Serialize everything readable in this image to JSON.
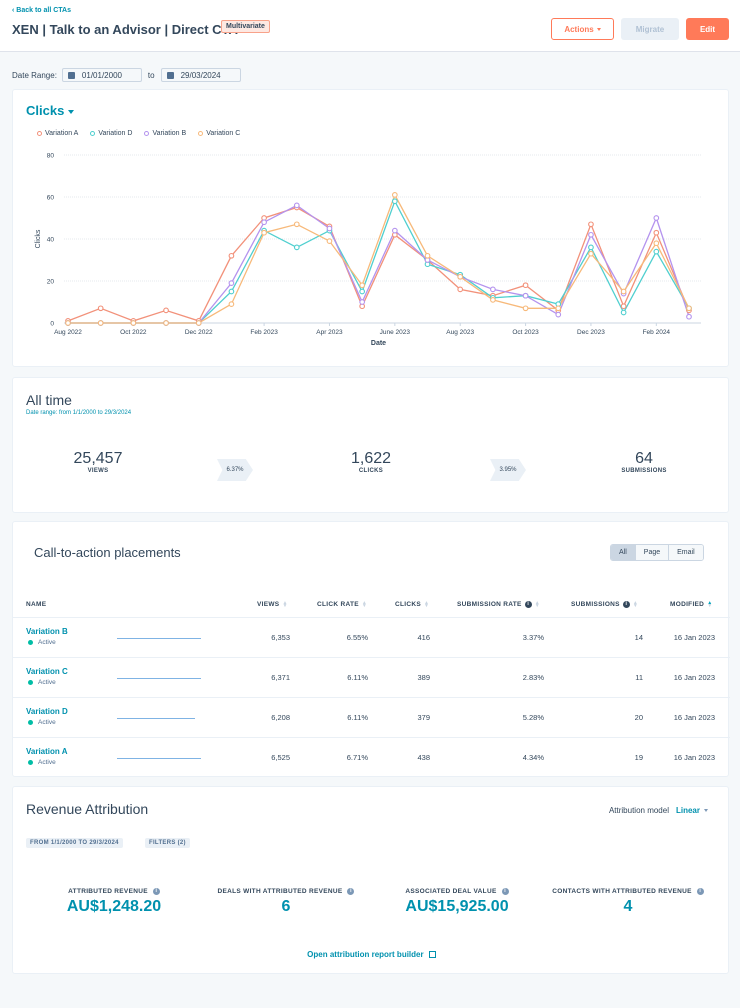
{
  "header": {
    "back_link": "‹ Back to all CTAs",
    "title": "XEN | Talk to an Advisor | Direct CTA",
    "badge": "Multivariate",
    "buttons": {
      "actions": "Actions",
      "migrate": "Migrate",
      "edit": "Edit"
    }
  },
  "date_range": {
    "label": "Date Range:",
    "from": "01/01/2000",
    "to_label": "to",
    "to": "29/03/2024"
  },
  "chart_card": {
    "metric": "Clicks"
  },
  "chart_data": {
    "type": "line",
    "title": "Clicks",
    "xlabel": "Date",
    "ylabel": "Clicks",
    "ylim": [
      0,
      80
    ],
    "yticks": [
      0,
      20,
      40,
      60,
      80
    ],
    "grid": true,
    "legend_position": "top-left",
    "x": [
      "Aug 2022",
      "Sep 2022",
      "Oct 2022",
      "Nov 2022",
      "Dec 2022",
      "Jan 2023",
      "Feb 2023",
      "Mar 2023",
      "Apr 2023",
      "May 2023",
      "June 2023",
      "Jul 2023",
      "Aug 2023",
      "Sep 2023",
      "Oct 2023",
      "Nov 2023",
      "Dec 2023",
      "Jan 2024",
      "Feb 2024",
      "Mar 2024"
    ],
    "xtick_labels": {
      "0": "Aug 2022",
      "2": "Oct 2022",
      "4": "Dec 2022",
      "6": "Feb 2023",
      "8": "Apr 2023",
      "10": "June 2023",
      "12": "Aug 2023",
      "14": "Oct 2023",
      "16": "Dec 2023",
      "18": "Feb 2024"
    },
    "series": [
      {
        "name": "Variation A",
        "color": "#f2917a",
        "values": [
          1,
          7,
          1,
          6,
          1,
          32,
          50,
          55,
          46,
          8,
          42,
          30,
          16,
          13,
          18,
          6,
          47,
          8,
          43,
          6
        ]
      },
      {
        "name": "Variation D",
        "color": "#4fcfcf",
        "values": [
          0,
          0,
          0,
          0,
          0,
          15,
          44,
          36,
          44,
          15,
          58,
          28,
          23,
          12,
          13,
          9,
          36,
          5,
          34,
          7
        ]
      },
      {
        "name": "Variation B",
        "color": "#b493ee",
        "values": [
          0,
          0,
          0,
          0,
          0,
          19,
          48,
          56,
          45,
          10,
          44,
          30,
          22,
          16,
          13,
          4,
          42,
          14,
          50,
          3
        ]
      },
      {
        "name": "Variation C",
        "color": "#f7b97a",
        "values": [
          0,
          0,
          0,
          0,
          0,
          9,
          43,
          47,
          39,
          18,
          61,
          32,
          22,
          11,
          7,
          7,
          33,
          15,
          38,
          7
        ]
      }
    ]
  },
  "all_time": {
    "title": "All time",
    "subtitle": "Date range: from 1/1/2000 to 29/3/2024",
    "views": {
      "value": "25,457",
      "label": "VIEWS"
    },
    "view_to_click": "6.37%",
    "clicks": {
      "value": "1,622",
      "label": "CLICKS"
    },
    "click_to_sub": "3.95%",
    "submissions": {
      "value": "64",
      "label": "SUBMISSIONS"
    }
  },
  "placements": {
    "title": "Call-to-action placements",
    "filters": [
      "All",
      "Page",
      "Email"
    ],
    "active_filter": "All",
    "columns": [
      "NAME",
      "VIEWS",
      "CLICK RATE",
      "CLICKS",
      "SUBMISSION RATE",
      "SUBMISSIONS",
      "MODIFIED"
    ],
    "rows": [
      {
        "name": "Variation B",
        "status": "Active",
        "views": "6,353",
        "click_rate": "6.55%",
        "clicks": "416",
        "submission_rate": "3.37%",
        "submissions": "14",
        "modified": "16 Jan 2023"
      },
      {
        "name": "Variation C",
        "status": "Active",
        "views": "6,371",
        "click_rate": "6.11%",
        "clicks": "389",
        "submission_rate": "2.83%",
        "submissions": "11",
        "modified": "16 Jan 2023"
      },
      {
        "name": "Variation D",
        "status": "Active",
        "views": "6,208",
        "click_rate": "6.11%",
        "clicks": "379",
        "submission_rate": "5.28%",
        "submissions": "20",
        "modified": "16 Jan 2023"
      },
      {
        "name": "Variation A",
        "status": "Active",
        "views": "6,525",
        "click_rate": "6.71%",
        "clicks": "438",
        "submission_rate": "4.34%",
        "submissions": "19",
        "modified": "16 Jan 2023"
      }
    ]
  },
  "revenue": {
    "title": "Revenue Attribution",
    "model_label": "Attribution model",
    "model_value": "Linear",
    "pills": [
      "FROM 1/1/2000 TO 29/3/2024",
      "FILTERS (2)"
    ],
    "stats": [
      {
        "label": "ATTRIBUTED REVENUE",
        "value": "AU$1,248.20"
      },
      {
        "label": "DEALS WITH ATTRIBUTED REVENUE",
        "value": "6"
      },
      {
        "label": "ASSOCIATED DEAL VALUE",
        "value": "AU$15,925.00"
      },
      {
        "label": "CONTACTS WITH ATTRIBUTED REVENUE",
        "value": "4"
      }
    ],
    "open_link": "Open attribution report builder"
  }
}
